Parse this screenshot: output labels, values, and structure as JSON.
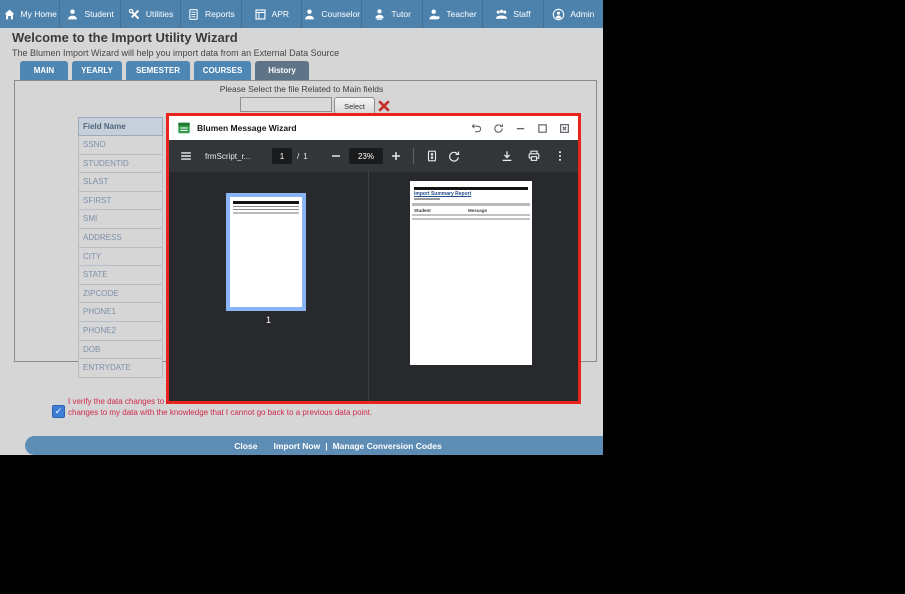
{
  "nav": {
    "items": [
      {
        "label": "My Home"
      },
      {
        "label": "Student"
      },
      {
        "label": "Utilities"
      },
      {
        "label": "Reports"
      },
      {
        "label": "APR"
      },
      {
        "label": "Counselor"
      },
      {
        "label": "Tutor"
      },
      {
        "label": "Teacher"
      },
      {
        "label": "Staff"
      },
      {
        "label": "Admin"
      }
    ]
  },
  "header": {
    "title": "Welcome to the Import Utility Wizard",
    "subtitle": "The Blumen Import Wizard will help you import data from an External Data Source"
  },
  "tabs": [
    {
      "label": "MAIN"
    },
    {
      "label": "YEARLY"
    },
    {
      "label": "SEMESTER"
    },
    {
      "label": "COURSES"
    },
    {
      "label": "History"
    }
  ],
  "active_tab": "History",
  "file_select": {
    "instruction": "Please Select the file Related to Main fields",
    "input_value": "",
    "button_label": "Select"
  },
  "field_table": {
    "header": "Field Name",
    "rows": [
      "SSNO",
      "STUDENTID",
      "SLAST",
      "SFIRST",
      "SMI",
      "ADDRESS",
      "CITY",
      "STATE",
      "ZIPCODE",
      "PHONE1",
      "PHONE2",
      "DOB",
      "ENTRYDATE"
    ]
  },
  "dialog": {
    "title": "Blumen Message Wizard",
    "viewer": {
      "filename": "frmScript_r...",
      "current_page": "1",
      "page_sep": "/",
      "total_pages": "1",
      "zoom": "23%",
      "thumb_label": "1",
      "report": {
        "title": "Import Summary Report",
        "col_left": "Student",
        "col_right": "Message"
      }
    }
  },
  "verify": {
    "check": "✓",
    "line1": "I verify the data changes to",
    "line2": "changes to my data with the knowledge that I cannot go back to a previous data point."
  },
  "footer": {
    "close": "Close",
    "import_now": "Import Now",
    "pipe": "|",
    "manage": "Manage Conversion Codes"
  },
  "colors": {
    "nav_blue": "#4d82ad",
    "tab_blue": "#4e87b4",
    "tab_active": "#5f7487",
    "dialog_border_red": "#e8241d",
    "toolbar_dark": "#323639",
    "viewer_dark": "#28292c",
    "selection_blue": "#8ab4f8",
    "footer_blue": "#5d8cb5",
    "warning_text_red": "#cf2b4b",
    "checkbox_blue": "#3f7fd6"
  }
}
